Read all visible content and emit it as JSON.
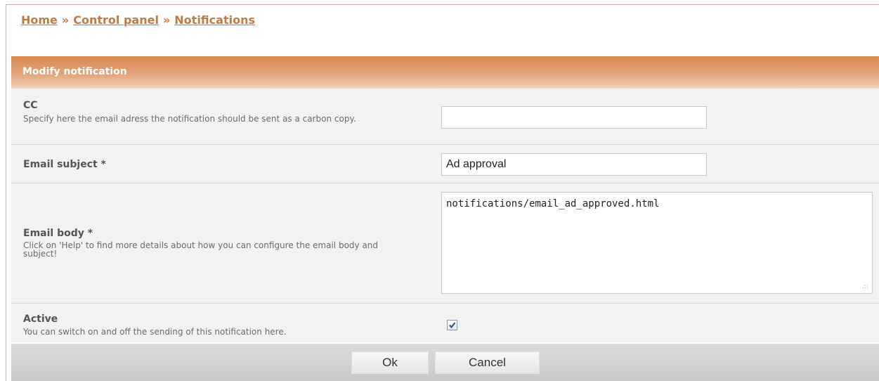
{
  "breadcrumb": {
    "home": "Home",
    "separator": "»",
    "control_panel": "Control panel",
    "notifications": "Notifications"
  },
  "panel": {
    "title": "Modify notification"
  },
  "form": {
    "cc": {
      "label": "CC",
      "description": "Specify here the email adress the notification should be sent as a carbon copy.",
      "value": ""
    },
    "subject": {
      "label": "Email subject *",
      "value": "Ad approval"
    },
    "body": {
      "label": "Email body *",
      "description": "Click on 'Help' to find more details about how you can configure the email body and subject!",
      "value": "notifications/email_ad_approved.html"
    },
    "active": {
      "label": "Active",
      "description": "You can switch on and off the sending of this notification here.",
      "checked": true
    }
  },
  "buttons": {
    "ok": "Ok",
    "cancel": "Cancel"
  },
  "colors": {
    "accent": "#d98b52",
    "link": "#c27a42",
    "row_bg": "#f2f2f2"
  }
}
